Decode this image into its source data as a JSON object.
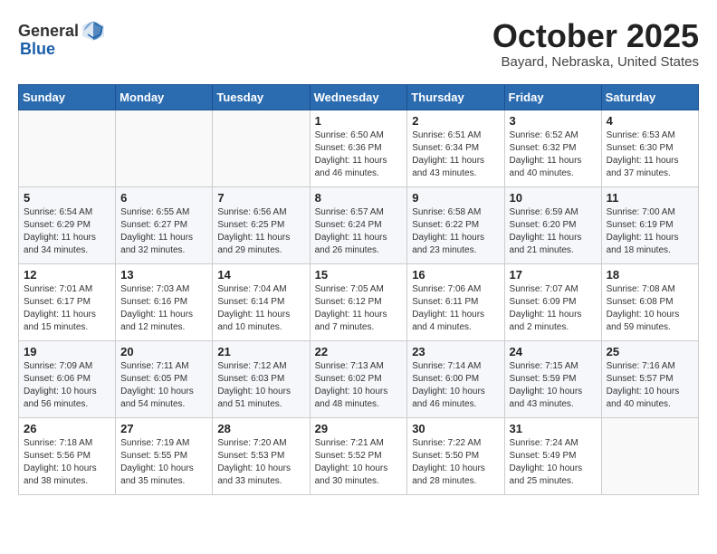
{
  "header": {
    "logo_general": "General",
    "logo_blue": "Blue",
    "month": "October 2025",
    "location": "Bayard, Nebraska, United States"
  },
  "weekdays": [
    "Sunday",
    "Monday",
    "Tuesday",
    "Wednesday",
    "Thursday",
    "Friday",
    "Saturday"
  ],
  "weeks": [
    [
      {
        "day": "",
        "info": ""
      },
      {
        "day": "",
        "info": ""
      },
      {
        "day": "",
        "info": ""
      },
      {
        "day": "1",
        "info": "Sunrise: 6:50 AM\nSunset: 6:36 PM\nDaylight: 11 hours\nand 46 minutes."
      },
      {
        "day": "2",
        "info": "Sunrise: 6:51 AM\nSunset: 6:34 PM\nDaylight: 11 hours\nand 43 minutes."
      },
      {
        "day": "3",
        "info": "Sunrise: 6:52 AM\nSunset: 6:32 PM\nDaylight: 11 hours\nand 40 minutes."
      },
      {
        "day": "4",
        "info": "Sunrise: 6:53 AM\nSunset: 6:30 PM\nDaylight: 11 hours\nand 37 minutes."
      }
    ],
    [
      {
        "day": "5",
        "info": "Sunrise: 6:54 AM\nSunset: 6:29 PM\nDaylight: 11 hours\nand 34 minutes."
      },
      {
        "day": "6",
        "info": "Sunrise: 6:55 AM\nSunset: 6:27 PM\nDaylight: 11 hours\nand 32 minutes."
      },
      {
        "day": "7",
        "info": "Sunrise: 6:56 AM\nSunset: 6:25 PM\nDaylight: 11 hours\nand 29 minutes."
      },
      {
        "day": "8",
        "info": "Sunrise: 6:57 AM\nSunset: 6:24 PM\nDaylight: 11 hours\nand 26 minutes."
      },
      {
        "day": "9",
        "info": "Sunrise: 6:58 AM\nSunset: 6:22 PM\nDaylight: 11 hours\nand 23 minutes."
      },
      {
        "day": "10",
        "info": "Sunrise: 6:59 AM\nSunset: 6:20 PM\nDaylight: 11 hours\nand 21 minutes."
      },
      {
        "day": "11",
        "info": "Sunrise: 7:00 AM\nSunset: 6:19 PM\nDaylight: 11 hours\nand 18 minutes."
      }
    ],
    [
      {
        "day": "12",
        "info": "Sunrise: 7:01 AM\nSunset: 6:17 PM\nDaylight: 11 hours\nand 15 minutes."
      },
      {
        "day": "13",
        "info": "Sunrise: 7:03 AM\nSunset: 6:16 PM\nDaylight: 11 hours\nand 12 minutes."
      },
      {
        "day": "14",
        "info": "Sunrise: 7:04 AM\nSunset: 6:14 PM\nDaylight: 11 hours\nand 10 minutes."
      },
      {
        "day": "15",
        "info": "Sunrise: 7:05 AM\nSunset: 6:12 PM\nDaylight: 11 hours\nand 7 minutes."
      },
      {
        "day": "16",
        "info": "Sunrise: 7:06 AM\nSunset: 6:11 PM\nDaylight: 11 hours\nand 4 minutes."
      },
      {
        "day": "17",
        "info": "Sunrise: 7:07 AM\nSunset: 6:09 PM\nDaylight: 11 hours\nand 2 minutes."
      },
      {
        "day": "18",
        "info": "Sunrise: 7:08 AM\nSunset: 6:08 PM\nDaylight: 10 hours\nand 59 minutes."
      }
    ],
    [
      {
        "day": "19",
        "info": "Sunrise: 7:09 AM\nSunset: 6:06 PM\nDaylight: 10 hours\nand 56 minutes."
      },
      {
        "day": "20",
        "info": "Sunrise: 7:11 AM\nSunset: 6:05 PM\nDaylight: 10 hours\nand 54 minutes."
      },
      {
        "day": "21",
        "info": "Sunrise: 7:12 AM\nSunset: 6:03 PM\nDaylight: 10 hours\nand 51 minutes."
      },
      {
        "day": "22",
        "info": "Sunrise: 7:13 AM\nSunset: 6:02 PM\nDaylight: 10 hours\nand 48 minutes."
      },
      {
        "day": "23",
        "info": "Sunrise: 7:14 AM\nSunset: 6:00 PM\nDaylight: 10 hours\nand 46 minutes."
      },
      {
        "day": "24",
        "info": "Sunrise: 7:15 AM\nSunset: 5:59 PM\nDaylight: 10 hours\nand 43 minutes."
      },
      {
        "day": "25",
        "info": "Sunrise: 7:16 AM\nSunset: 5:57 PM\nDaylight: 10 hours\nand 40 minutes."
      }
    ],
    [
      {
        "day": "26",
        "info": "Sunrise: 7:18 AM\nSunset: 5:56 PM\nDaylight: 10 hours\nand 38 minutes."
      },
      {
        "day": "27",
        "info": "Sunrise: 7:19 AM\nSunset: 5:55 PM\nDaylight: 10 hours\nand 35 minutes."
      },
      {
        "day": "28",
        "info": "Sunrise: 7:20 AM\nSunset: 5:53 PM\nDaylight: 10 hours\nand 33 minutes."
      },
      {
        "day": "29",
        "info": "Sunrise: 7:21 AM\nSunset: 5:52 PM\nDaylight: 10 hours\nand 30 minutes."
      },
      {
        "day": "30",
        "info": "Sunrise: 7:22 AM\nSunset: 5:50 PM\nDaylight: 10 hours\nand 28 minutes."
      },
      {
        "day": "31",
        "info": "Sunrise: 7:24 AM\nSunset: 5:49 PM\nDaylight: 10 hours\nand 25 minutes."
      },
      {
        "day": "",
        "info": ""
      }
    ]
  ]
}
